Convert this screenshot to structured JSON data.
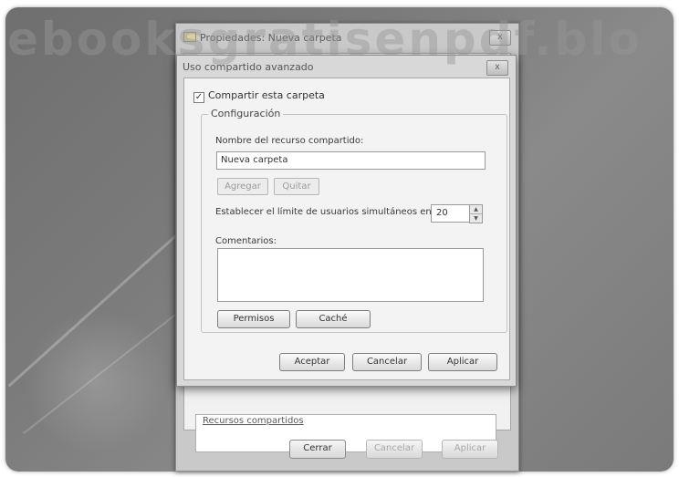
{
  "watermark": "ebooksgratisenpdf.blo",
  "colors": {
    "desktop": "#7b7b7b",
    "dialog": "#f3f3f3",
    "title_bar": "#d8d8d8"
  },
  "outer_window": {
    "title": "Propiedades: Nueva carpeta",
    "close_glyph": "x",
    "link_text": "Recursos compartidos",
    "buttons": {
      "close": "Cerrar",
      "cancel": "Cancelar",
      "apply": "Aplicar"
    }
  },
  "advanced_dialog": {
    "title": "Uso compartido avanzado",
    "close_glyph": "x",
    "share_checkbox": {
      "label": "Compartir esta carpeta",
      "checked": true,
      "mark": "✓"
    },
    "settings_group": {
      "label": "Configuración",
      "share_name_label": "Nombre del recurso compartido:",
      "share_name_value": "Nueva carpeta",
      "add_button": "Agregar",
      "remove_button": "Quitar",
      "user_limit_label": "Establecer el límite de usuarios simultáneos en:",
      "user_limit_value": "20",
      "comments_label": "Comentarios:",
      "comments_value": "",
      "permissions_button": "Permisos",
      "cache_button": "Caché"
    },
    "buttons": {
      "ok": "Aceptar",
      "cancel": "Cancelar",
      "apply": "Aplicar"
    }
  }
}
